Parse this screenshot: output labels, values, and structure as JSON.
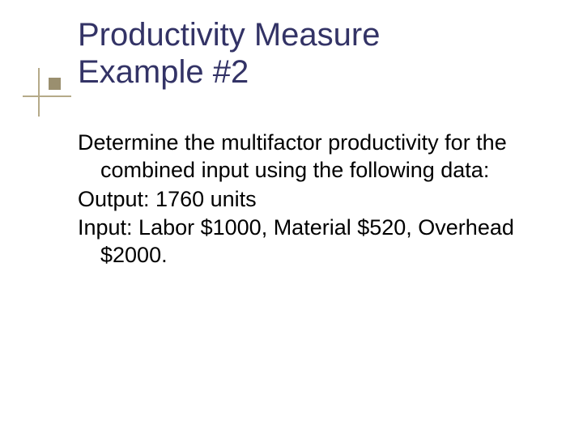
{
  "title_line1": "Productivity Measure",
  "title_line2": "Example #2",
  "body": {
    "para1": "Determine the multifactor productivity for the combined input using the following data:",
    "para2": "Output: 1760 units",
    "para3": "Input: Labor $1000, Material $520, Overhead $2000."
  }
}
